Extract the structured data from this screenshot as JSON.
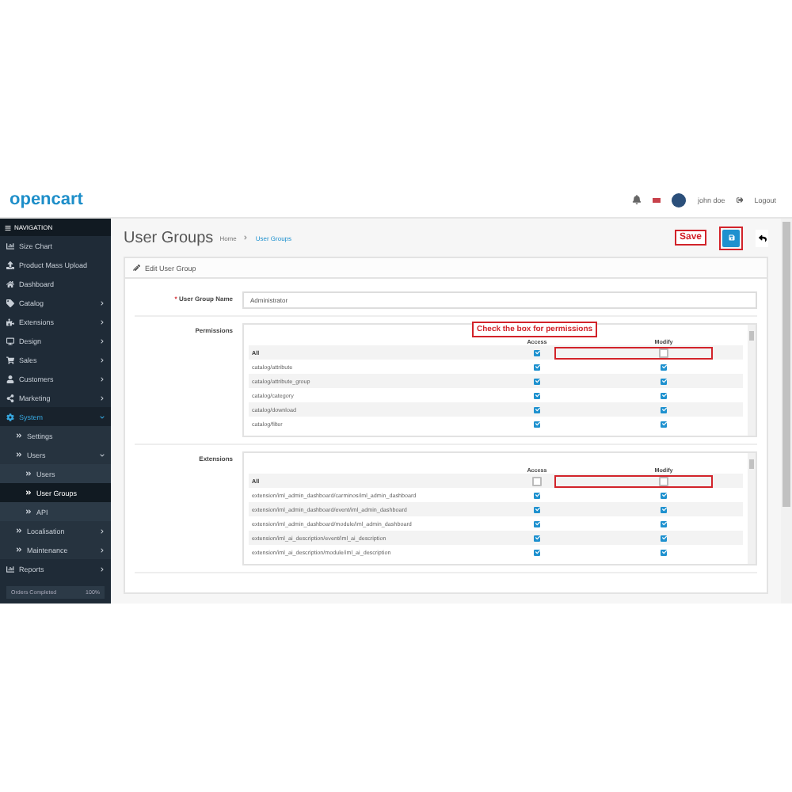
{
  "header": {
    "logo": "opencart",
    "user": "john doe",
    "logout": "Logout"
  },
  "navigation": {
    "title": "NAVIGATION",
    "items": [
      {
        "label": "Size Chart"
      },
      {
        "label": "Product Mass Upload"
      },
      {
        "label": "Dashboard"
      },
      {
        "label": "Catalog",
        "expanded": false
      },
      {
        "label": "Extensions",
        "expanded": false
      },
      {
        "label": "Design",
        "expanded": false
      },
      {
        "label": "Sales",
        "expanded": false
      },
      {
        "label": "Customers",
        "expanded": false
      },
      {
        "label": "Marketing",
        "expanded": false
      },
      {
        "label": "System",
        "expanded": true,
        "children": [
          {
            "label": "Settings",
            "selected": false
          },
          {
            "label": "Users",
            "expanded": true,
            "children": [
              {
                "label": "Users",
                "selected": false
              },
              {
                "label": "User Groups",
                "selected": true
              },
              {
                "label": "API",
                "selected": false
              }
            ]
          },
          {
            "label": "Localisation",
            "expanded": false
          },
          {
            "label": "Maintenance",
            "expanded": false
          }
        ]
      },
      {
        "label": "Reports",
        "expanded": false
      }
    ],
    "footer": {
      "label": "Orders Completed",
      "value": "100%"
    }
  },
  "page": {
    "title": "User Groups",
    "breadcrumbs": [
      "Home",
      "User Groups"
    ]
  },
  "annotations": {
    "save": "Save",
    "permissions": "Check the box for permissions"
  },
  "panel": {
    "title": "Edit User Group",
    "name_label": "User Group Name",
    "required_mark": "*",
    "name_value": "Administrator",
    "sections": [
      {
        "label": "Permissions",
        "highlight_all": true,
        "columns": [
          "Access",
          "Modify"
        ],
        "rows": [
          {
            "name": "All",
            "access": true,
            "modify": false
          },
          {
            "name": "catalog/attribute",
            "access": true,
            "modify": true
          },
          {
            "name": "catalog/attribute_group",
            "access": true,
            "modify": true
          },
          {
            "name": "catalog/category",
            "access": true,
            "modify": true
          },
          {
            "name": "catalog/download",
            "access": true,
            "modify": true
          },
          {
            "name": "catalog/filter",
            "access": true,
            "modify": true
          }
        ]
      },
      {
        "label": "Extensions",
        "highlight_all": true,
        "columns": [
          "Access",
          "Modify"
        ],
        "rows": [
          {
            "name": "All",
            "access": false,
            "modify": false
          },
          {
            "name": "extension/iml_admin_dashboard/carminos/iml_admin_dashboard",
            "access": true,
            "modify": true
          },
          {
            "name": "extension/iml_admin_dashboard/event/iml_admin_dashboard",
            "access": true,
            "modify": true
          },
          {
            "name": "extension/iml_admin_dashboard/module/iml_admin_dashboard",
            "access": true,
            "modify": true
          },
          {
            "name": "extension/iml_ai_description/event/iml_ai_description",
            "access": true,
            "modify": true
          },
          {
            "name": "extension/iml_ai_description/module/iml_ai_description",
            "access": true,
            "modify": true
          }
        ]
      }
    ]
  }
}
